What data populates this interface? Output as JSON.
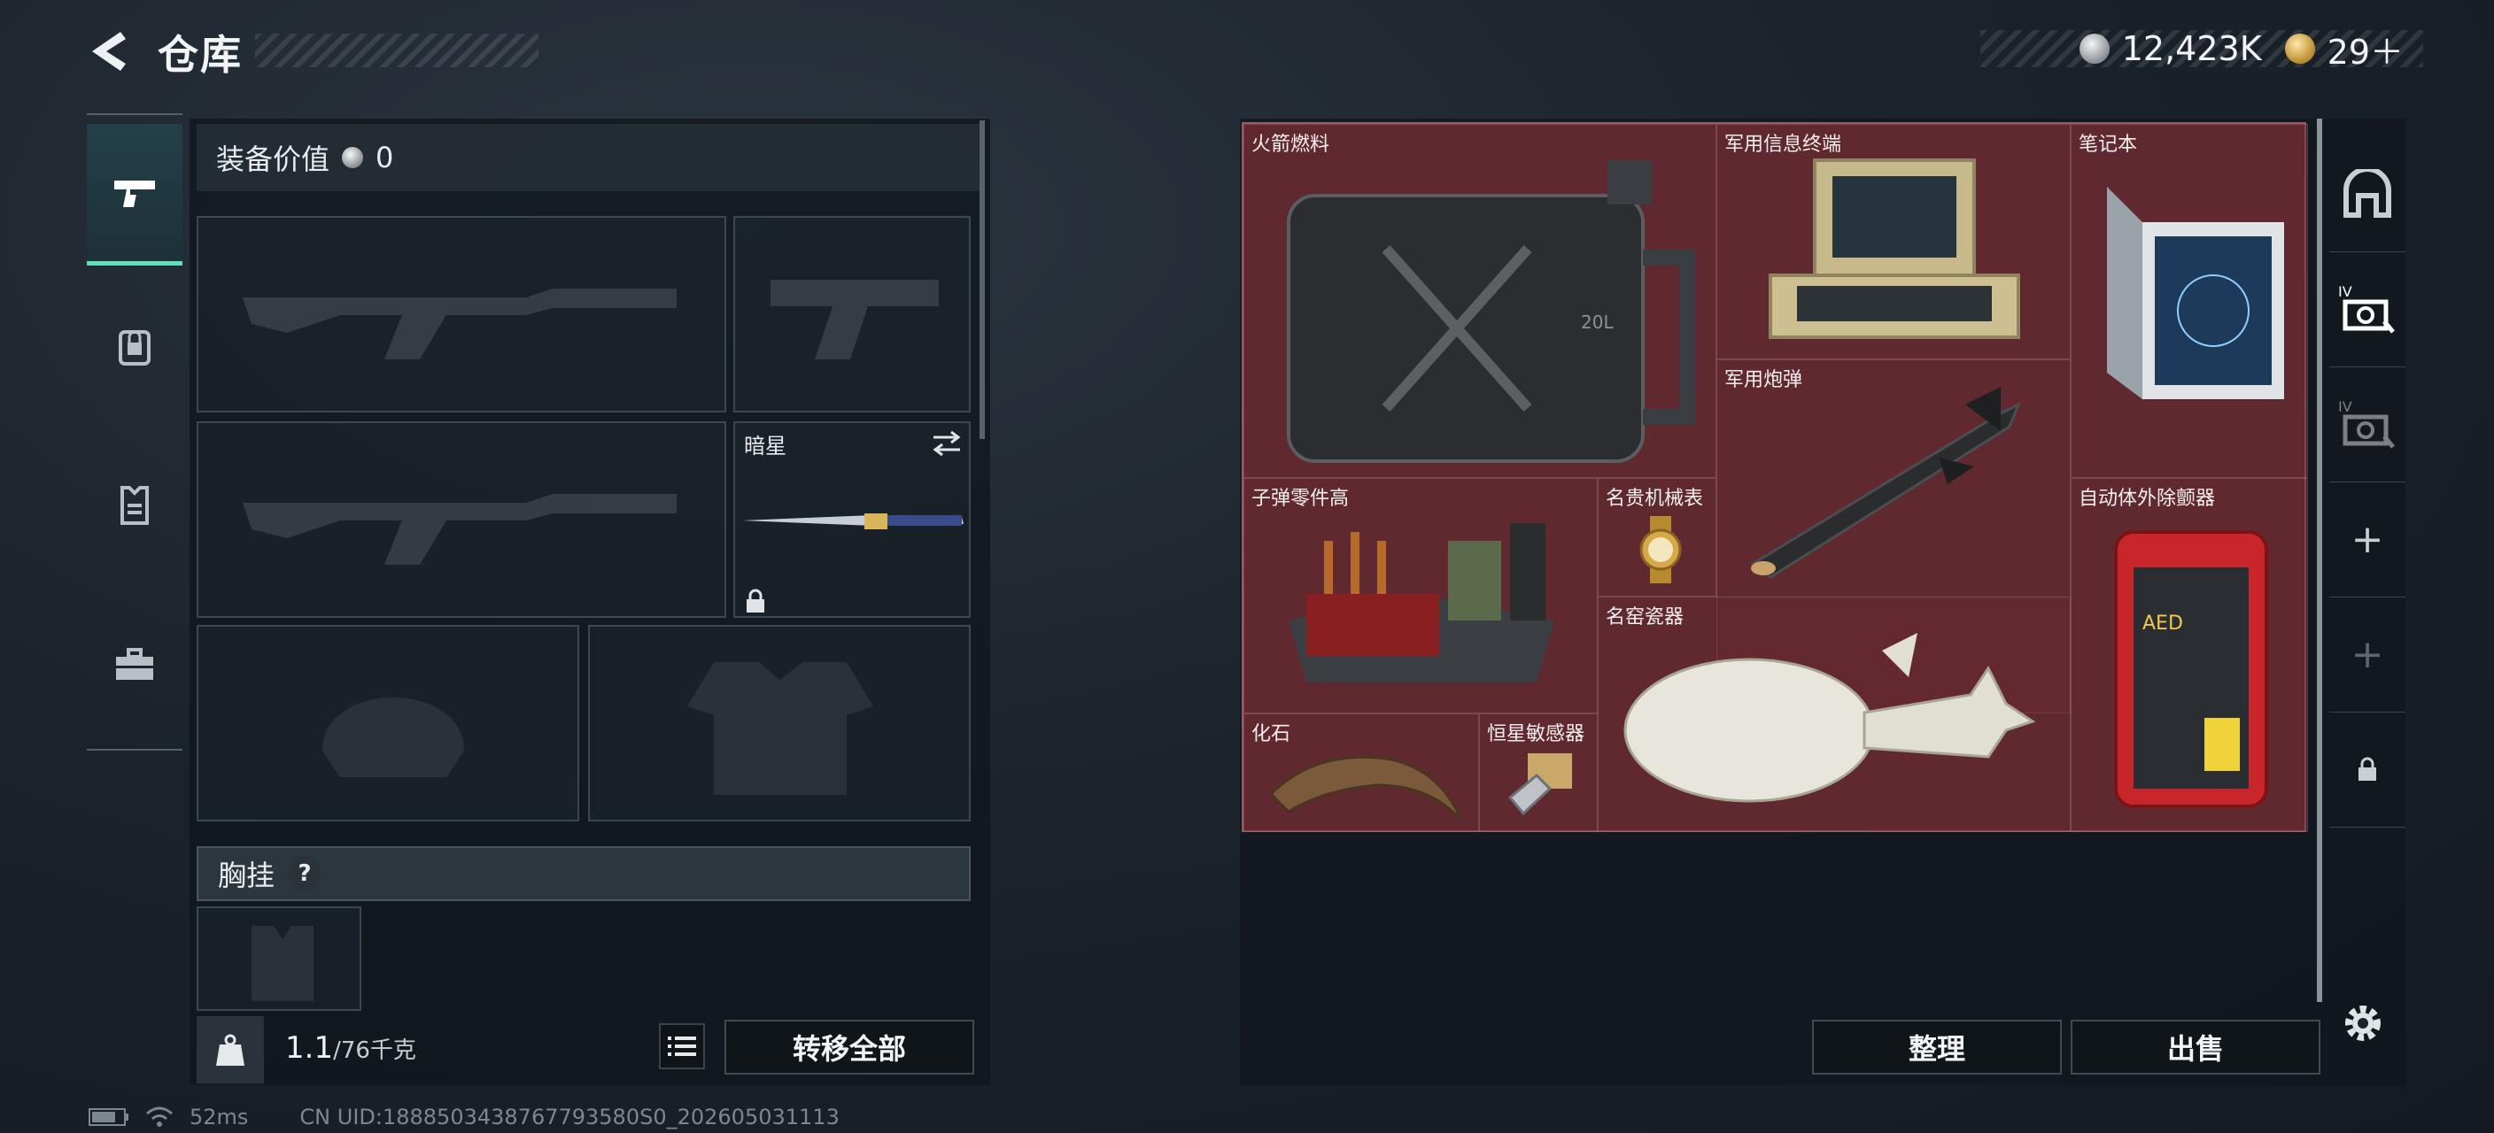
{
  "header": {
    "title": "仓库",
    "currencies": [
      {
        "icon": "silver-coin-icon",
        "value": "12,423K"
      },
      {
        "icon": "gold-coin-icon",
        "value": "29＋"
      }
    ]
  },
  "left_nav": [
    {
      "icon": "pistol-icon",
      "active": true
    },
    {
      "icon": "backpack-lock-icon",
      "active": false
    },
    {
      "icon": "vest-icon",
      "active": false
    },
    {
      "icon": "toolbox-icon",
      "active": false
    }
  ],
  "equipment": {
    "value_label": "装备价值",
    "value": "0",
    "slots": [
      {
        "name": "primary-weapon-1",
        "label": "",
        "icon": "rifle-silhouette-icon"
      },
      {
        "name": "pistol-slot",
        "label": "",
        "icon": "pistol-silhouette-icon"
      },
      {
        "name": "primary-weapon-2",
        "label": "",
        "icon": "rifle-silhouette-icon"
      },
      {
        "name": "melee-slot",
        "label": "暗星",
        "icon": "knife-icon"
      },
      {
        "name": "helmet-slot",
        "label": "",
        "icon": "helmet-silhouette-icon"
      },
      {
        "name": "armor-slot",
        "label": "",
        "icon": "armor-silhouette-icon"
      }
    ],
    "chest_rig_label": "胸挂",
    "chest_rig_help": "?",
    "weight_current": "1.1",
    "weight_max": "/76千克",
    "transfer_all": "转移全部"
  },
  "stash_items": [
    {
      "name": "rocket-fuel",
      "label": "火箭燃料",
      "icon": "jerrycan-icon"
    },
    {
      "name": "military-terminal",
      "label": "军用信息终端",
      "icon": "terminal-case-icon"
    },
    {
      "name": "laptop",
      "label": "笔记本",
      "icon": "laptop-icon"
    },
    {
      "name": "military-shell",
      "label": "军用炮弹",
      "icon": "missile-icon"
    },
    {
      "name": "bullet-parts",
      "label": "子弹零件高",
      "icon": "ammo-crate-icon"
    },
    {
      "name": "luxury-watch",
      "label": "名贵机械表",
      "icon": "watch-icon"
    },
    {
      "name": "aed",
      "label": "自动体外除颤器",
      "icon": "aed-icon"
    },
    {
      "name": "famous-porcelain",
      "label": "名窑瓷器",
      "icon": "vase-icon"
    },
    {
      "name": "fossil",
      "label": "化石",
      "icon": "claw-fossil-icon"
    },
    {
      "name": "star-sensor",
      "label": "恒星敏感器",
      "icon": "sensor-icon"
    }
  ],
  "actions": {
    "sort": "整理",
    "sell": "出售"
  },
  "right_nav": [
    {
      "icon": "safe-box-icon"
    },
    {
      "icon": "stash-iv-icon",
      "badge": "IV"
    },
    {
      "icon": "stash-iv-dim-icon",
      "badge": "IV"
    },
    {
      "icon": "add-icon",
      "text": "+"
    },
    {
      "icon": "add-dim-icon",
      "text": "+"
    },
    {
      "icon": "lock-icon"
    }
  ],
  "status_bar": {
    "ping": "52ms",
    "uid": "CN UID:1888503438767793580S0_202605031113"
  },
  "colors": {
    "accent": "#5fe0b5",
    "stash_bg": "#5a2a31"
  }
}
